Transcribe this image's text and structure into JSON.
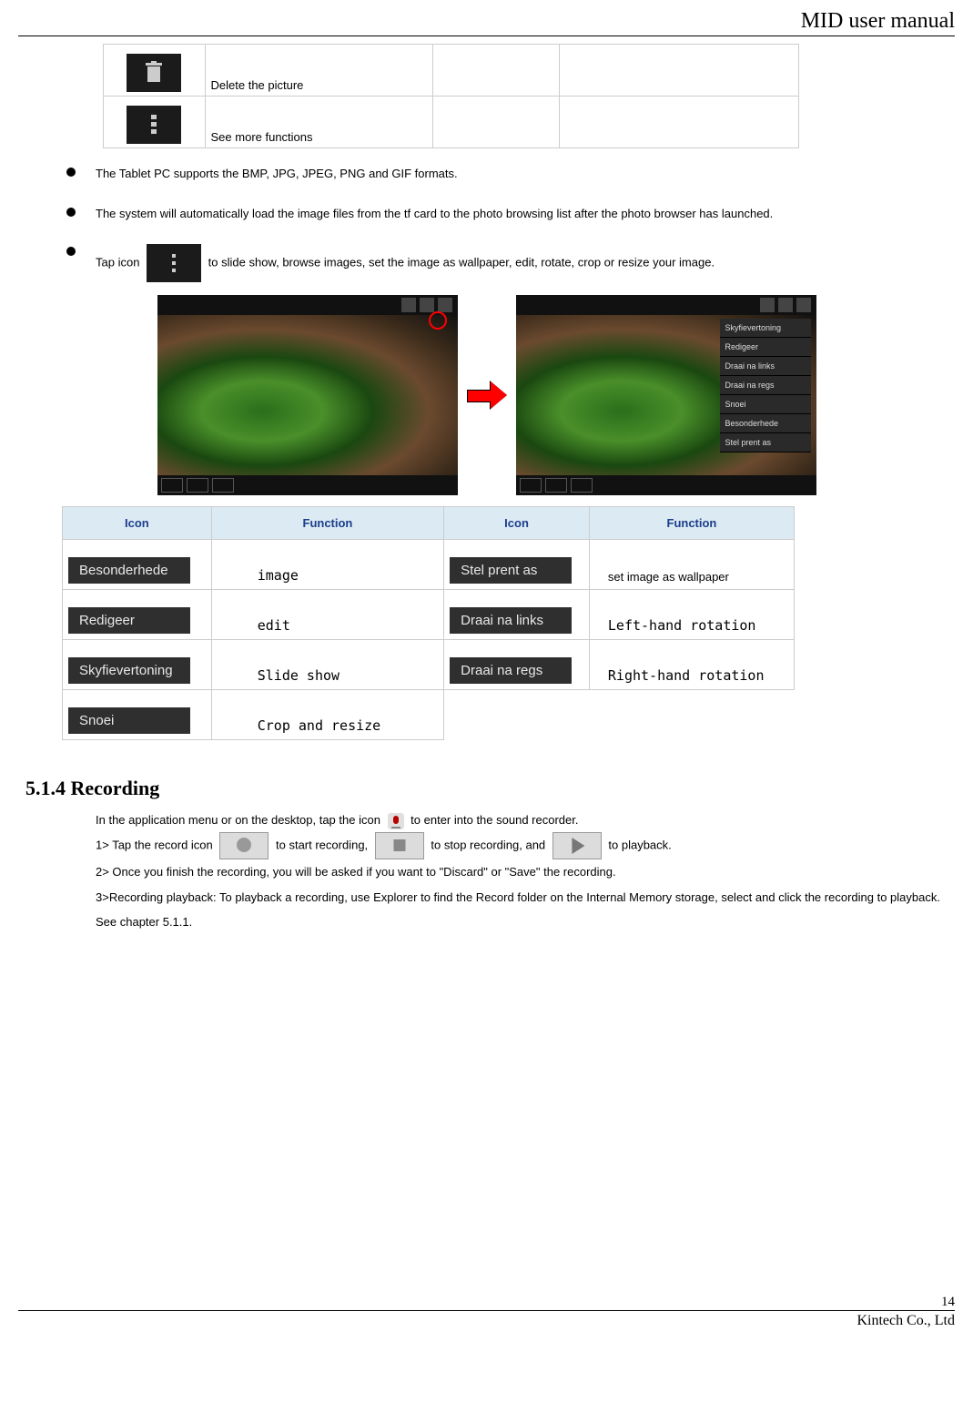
{
  "header": {
    "title": "MID user manual"
  },
  "top_table": {
    "rows": [
      {
        "icon": "trash-icon",
        "label": "Delete the picture"
      },
      {
        "icon": "more-icon",
        "label": "See more functions"
      }
    ]
  },
  "bullets": {
    "b1": "The Tablet PC supports the BMP, JPG, JPEG, PNG and GIF formats.",
    "b2": "The system will automatically load the image files from the tf card to the photo browsing list after the photo browser has launched.",
    "b3_before": "Tap icon",
    "b3_after": " to slide show, browse images, set the image as wallpaper, edit, rotate, crop or resize your image."
  },
  "screen_menu": {
    "items": [
      "Skyfievertoning",
      "Redigeer",
      "Draai na links",
      "Draai na regs",
      "Snoei",
      "Besonderhede",
      "Stel prent as"
    ]
  },
  "func_table": {
    "headers": {
      "h1": "Icon",
      "h2": "Function",
      "h3": "Icon",
      "h4": "Function"
    },
    "rows": [
      {
        "icon1": "Besonderhede",
        "func1": "image",
        "icon2": "Stel prent as",
        "func2": "set image as wallpaper",
        "func2_sans": true
      },
      {
        "icon1": "Redigeer",
        "func1": "edit",
        "icon2": "Draai na links",
        "func2": "Left-hand rotation"
      },
      {
        "icon1": "Skyfievertoning",
        "func1": "Slide show",
        "icon2": "Draai na regs",
        "func2": "Right-hand rotation"
      },
      {
        "icon1": "Snoei",
        "func1": "Crop and resize",
        "icon2": "",
        "func2": ""
      }
    ]
  },
  "section": {
    "heading": "5.1.4 Recording"
  },
  "recording": {
    "line0_a": "In the application menu or on the desktop, tap the icon ",
    "line0_b": " to enter into the sound recorder.",
    "line1_a": "1> Tap the record icon ",
    "line1_b": " to start recording, ",
    "line1_c": " to stop recording, and ",
    "line1_d": " to playback.",
    "line2": "2> Once you finish the recording, you will be asked if you want to \"Discard\" or \"Save\" the recording.",
    "line3": "3>Recording playback: To playback a recording, use Explorer to find the Record folder on the Internal Memory storage, select and click the recording to playback. See chapter 5.1.1."
  },
  "footer": {
    "page": "14",
    "company": "Kintech Co., Ltd"
  }
}
